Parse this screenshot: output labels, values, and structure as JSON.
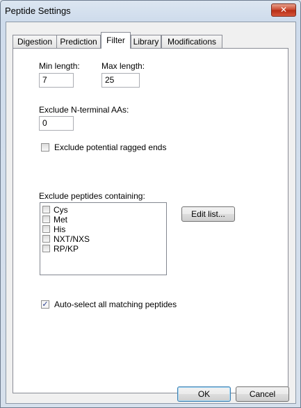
{
  "window": {
    "title": "Peptide Settings",
    "close_glyph": "✕"
  },
  "tabs": [
    {
      "label": "Digestion",
      "active": false
    },
    {
      "label": "Prediction",
      "active": false
    },
    {
      "label": "Filter",
      "active": true
    },
    {
      "label": "Library",
      "active": false
    },
    {
      "label": "Modifications",
      "active": false
    }
  ],
  "filter": {
    "min_length_label": "Min length:",
    "min_length_value": "7",
    "max_length_label": "Max length:",
    "max_length_value": "25",
    "exclude_nterm_label": "Exclude N-terminal AAs:",
    "exclude_nterm_value": "0",
    "ragged_ends_label": "Exclude potential ragged ends",
    "ragged_ends_checked": false,
    "exclude_peptides_label": "Exclude peptides containing:",
    "exclude_items": [
      {
        "label": "Cys",
        "checked": false
      },
      {
        "label": "Met",
        "checked": false
      },
      {
        "label": "His",
        "checked": false
      },
      {
        "label": "NXT/NXS",
        "checked": false
      },
      {
        "label": "RP/KP",
        "checked": false
      }
    ],
    "edit_list_label": "Edit list...",
    "auto_select_label": "Auto-select all matching peptides",
    "auto_select_checked": true,
    "check_glyph": "✓"
  },
  "buttons": {
    "ok_label": "OK",
    "cancel_label": "Cancel"
  }
}
